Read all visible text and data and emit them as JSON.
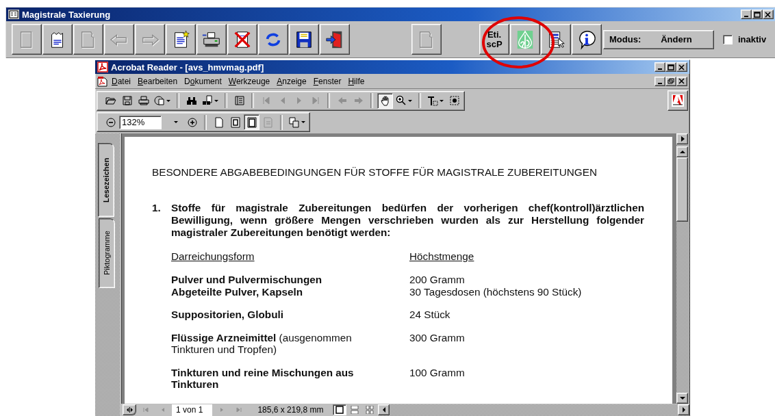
{
  "app_window": {
    "title": "Magistrale Taxierung",
    "toolbar_groups": [
      [
        {
          "kind": "icon",
          "disabled": true
        },
        {
          "kind": "icon",
          "disabled": false
        },
        {
          "kind": "icon",
          "disabled": true
        },
        {
          "kind": "icon",
          "disabled": true
        },
        {
          "kind": "icon",
          "disabled": true
        },
        {
          "kind": "icon",
          "disabled": false
        },
        {
          "kind": "icon",
          "disabled": false
        },
        {
          "kind": "icon",
          "disabled": false
        },
        {
          "kind": "icon",
          "disabled": false
        },
        {
          "kind": "icon",
          "disabled": false
        },
        {
          "kind": "icon",
          "disabled": false
        }
      ],
      [
        {
          "kind": "icon",
          "disabled": true
        }
      ],
      [
        {
          "kind": "text",
          "label": "Eti.\nscP",
          "disabled": false
        },
        {
          "kind": "icon",
          "disabled": false
        },
        {
          "kind": "icon",
          "disabled": false
        },
        {
          "kind": "icon",
          "disabled": false
        }
      ]
    ],
    "mode": {
      "label": "Modus:",
      "value": "Ändern"
    },
    "inactive": {
      "label": "inaktiv",
      "checked": false
    }
  },
  "reader": {
    "title": "Acrobat Reader - [avs_hmvmag.pdf]",
    "menu": [
      {
        "key": "D",
        "after": "atei"
      },
      {
        "key": "B",
        "after": "earbeiten"
      },
      {
        "before": "D",
        "key": "o",
        "after": "kument"
      },
      {
        "key": "W",
        "after": "erkzeuge"
      },
      {
        "key": "A",
        "after": "nzeige"
      },
      {
        "key": "F",
        "after": "enster"
      },
      {
        "key": "H",
        "after": "ilfe"
      }
    ],
    "toolbar_row_1": [
      {
        "kind": "tool",
        "selected": false,
        "disabled": false
      },
      {
        "kind": "tool",
        "selected": false,
        "disabled": false
      },
      {
        "kind": "tool",
        "selected": false,
        "disabled": false
      },
      {
        "kind": "split",
        "selected": false,
        "disabled": false
      },
      {
        "kind": "separator"
      },
      {
        "kind": "tool",
        "selected": false,
        "disabled": false
      },
      {
        "kind": "split",
        "selected": false,
        "disabled": false
      },
      {
        "kind": "separator"
      },
      {
        "kind": "tool",
        "selected": false,
        "disabled": false
      },
      {
        "kind": "separator"
      },
      {
        "kind": "tool",
        "selected": false,
        "disabled": true
      },
      {
        "kind": "tool",
        "selected": false,
        "disabled": true
      },
      {
        "kind": "tool",
        "selected": false,
        "disabled": true
      },
      {
        "kind": "tool",
        "selected": false,
        "disabled": true
      },
      {
        "kind": "separator"
      },
      {
        "kind": "tool",
        "selected": false,
        "disabled": true
      },
      {
        "kind": "tool",
        "selected": false,
        "disabled": true
      },
      {
        "kind": "separator"
      },
      {
        "kind": "tool",
        "selected": true,
        "disabled": false
      },
      {
        "kind": "split",
        "selected": false,
        "disabled": false
      },
      {
        "kind": "separator"
      },
      {
        "kind": "split",
        "selected": false,
        "disabled": false
      },
      {
        "kind": "tool",
        "selected": false,
        "disabled": false
      }
    ],
    "toolbar_row_2": [
      {
        "kind": "tool",
        "selected": false,
        "disabled": false
      },
      {
        "kind": "field",
        "value": "132%"
      },
      {
        "kind": "tool",
        "selected": false,
        "disabled": false
      },
      {
        "kind": "separator"
      },
      {
        "kind": "tool",
        "selected": false,
        "disabled": false
      },
      {
        "kind": "tool",
        "selected": false,
        "disabled": false
      },
      {
        "kind": "tool",
        "selected": true,
        "disabled": false
      },
      {
        "kind": "tool",
        "selected": false,
        "disabled": true
      },
      {
        "kind": "separator"
      },
      {
        "kind": "split",
        "selected": false,
        "disabled": false
      }
    ],
    "nav_tabs": [
      {
        "label": "Lesezeichen",
        "selected": true
      },
      {
        "label": "Piktogramme",
        "selected": false
      }
    ],
    "document": {
      "heading": "BESONDERE ABGABEBEDINGUNGEN FÜR STOFFE FÜR MAGISTRALE ZUBEREITUNGEN",
      "items": [
        {
          "number": "1.",
          "text": "Stoffe für magistrale Zubereitungen bedürfen der vorherigen chef(kontroll)ärztlichen Bewilligung, wenn größere Mengen verschrieben wurden als zur Herstellung folgender magistraler Zubereitungen benötigt werden:",
          "table": {
            "columns": [
              "Darreichungsform",
              "Höchstmenge"
            ],
            "groups": [
              [
                {
                  "form": "Pulver und Pulvermischungen",
                  "amount": "200 Gramm"
                },
                {
                  "form": "Abgeteilte Pulver, Kapseln",
                  "amount": "30 Tagesdosen (höchstens 90 Stück)"
                }
              ],
              [
                {
                  "form": "Suppositorien, Globuli",
                  "amount": "24 Stück"
                }
              ],
              [
                {
                  "form": "Flüssige Arzneimittel",
                  "note": "(ausgenommen Tinkturen und Tropfen)",
                  "amount": "300 Gramm"
                }
              ],
              [
                {
                  "form": "Tinkturen und reine Mischungen aus Tinkturen",
                  "amount": "100 Gramm"
                }
              ]
            ]
          }
        }
      ]
    },
    "status": {
      "page": "1 von 1",
      "size": "185,6 x 219,8 mm",
      "views": [
        {
          "selected": true
        },
        {
          "selected": false
        },
        {
          "selected": false
        }
      ]
    }
  }
}
